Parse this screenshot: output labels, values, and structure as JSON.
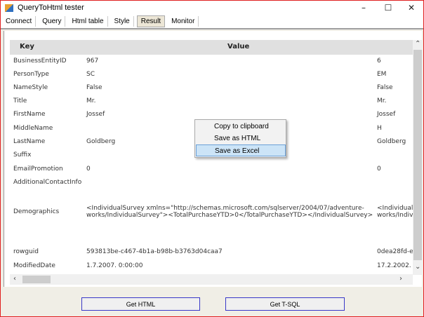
{
  "window": {
    "title": "QueryToHtml tester",
    "minimize": "–",
    "maximize": "☐",
    "close": "✕"
  },
  "tabs": [
    {
      "label": "Connect"
    },
    {
      "label": "Query"
    },
    {
      "label": "Html table"
    },
    {
      "label": "Style"
    },
    {
      "label": "Result",
      "active": true
    },
    {
      "label": "Monitor"
    }
  ],
  "grid": {
    "headers": {
      "key": "Key",
      "value": "Value"
    },
    "rows": [
      {
        "key": "BusinessEntityID",
        "v1": "967",
        "v2": "6"
      },
      {
        "key": "PersonType",
        "v1": "SC",
        "v2": "EM"
      },
      {
        "key": "NameStyle",
        "v1": "False",
        "v2": "False"
      },
      {
        "key": "Title",
        "v1": "Mr.",
        "v2": "Mr."
      },
      {
        "key": "FirstName",
        "v1": "Jossef",
        "v2": "Jossef"
      },
      {
        "key": "MiddleName",
        "v1": "",
        "v2": "H"
      },
      {
        "key": "LastName",
        "v1": "Goldberg",
        "v2": "Goldberg"
      },
      {
        "key": "Suffix",
        "v1": "",
        "v2": ""
      },
      {
        "key": "EmailPromotion",
        "v1": "0",
        "v2": "0"
      },
      {
        "key": "AdditionalContactInfo",
        "v1": "",
        "v2": ""
      },
      {
        "key": "Demographics",
        "v1": "<IndividualSurvey xmlns=\"http://schemas.microsoft.com/sqlserver/2004/07/adventure-\nworks/IndividualSurvey\"><TotalPurchaseYTD>0</TotalPurchaseYTD></IndividualSurvey>",
        "v2": "<IndividualS\nworks/Indiv"
      },
      {
        "key": "rowguid",
        "v1": "593813be-c467-4b1a-b98b-b3763d04caa7",
        "v2": "0dea28fd-ef"
      },
      {
        "key": "ModifiedDate",
        "v1": "1.7.2007. 0:00:00",
        "v2": "17.2.2002. 0"
      }
    ]
  },
  "context_menu": {
    "items": [
      {
        "label": "Copy to clipboard"
      },
      {
        "label": "Save as HTML"
      },
      {
        "label": "Save as Excel",
        "highlighted": true
      }
    ]
  },
  "buttons": {
    "get_html": "Get HTML",
    "get_tsql": "Get T-SQL"
  }
}
